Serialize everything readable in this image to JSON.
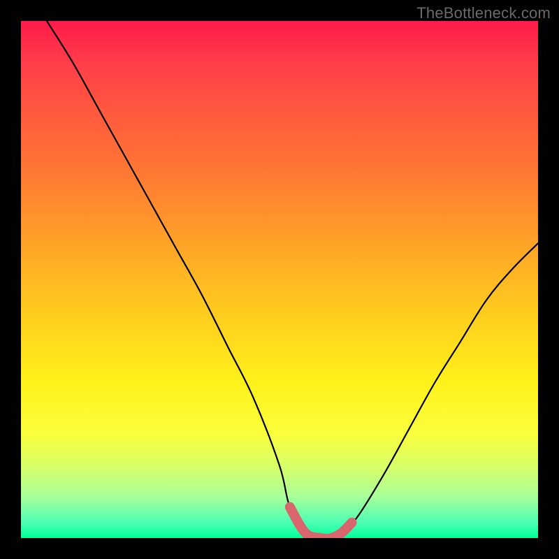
{
  "watermark": "TheBottleneck.com",
  "chart_data": {
    "type": "line",
    "title": "",
    "xlabel": "",
    "ylabel": "",
    "xlim": [
      0,
      100
    ],
    "ylim": [
      0,
      100
    ],
    "series": [
      {
        "name": "bottleneck-curve",
        "x": [
          5,
          10,
          15,
          20,
          25,
          30,
          35,
          40,
          45,
          50,
          52,
          55,
          58,
          60,
          62,
          65,
          70,
          75,
          80,
          85,
          90,
          95,
          100
        ],
        "values": [
          100,
          92,
          83,
          74,
          65,
          56,
          47,
          37,
          27,
          14,
          6,
          1,
          0,
          0,
          1,
          4,
          12,
          21,
          30,
          38,
          46,
          52,
          57
        ]
      }
    ],
    "highlight": {
      "name": "optimal-region",
      "x": [
        52,
        55,
        58,
        60,
        62,
        64
      ],
      "values": [
        6,
        1,
        0,
        0,
        1,
        3
      ]
    },
    "colors": {
      "curve": "#000000",
      "highlight": "#d9666d",
      "gradient_top": "#ff1a4a",
      "gradient_mid": "#ffd21f",
      "gradient_bottom": "#00ff99"
    }
  }
}
